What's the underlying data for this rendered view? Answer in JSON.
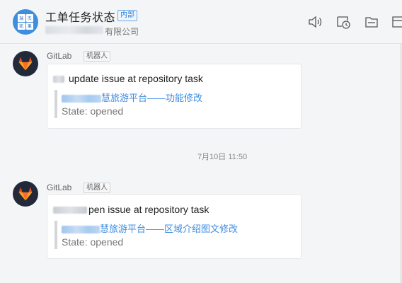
{
  "header": {
    "title": "工单任务状态",
    "badge": "内部",
    "company_suffix": "有限公司",
    "avatar_chars": [
      "瑞",
      "杰",
      "凯",
      "果"
    ],
    "toolbar": [
      "speaker-icon",
      "history-icon",
      "folder-icon",
      "more-icon"
    ]
  },
  "messages": [
    {
      "sender": "GitLab",
      "tag": "机器人",
      "action": "update issue at repository task",
      "link_suffix": "慧旅游平台——功能修改",
      "state": "State: opened"
    },
    {
      "sender": "GitLab",
      "tag": "机器人",
      "action": "pen issue at repository task",
      "link_suffix": "慧旅游平台——区域介绍图文修改",
      "state": "State: opened"
    }
  ],
  "timestamp": "7月10日 11:50",
  "colors": {
    "accent": "#3d8de0",
    "bot_avatar_bg": "#222a3a",
    "gitlab_orange": "#e8542a"
  }
}
